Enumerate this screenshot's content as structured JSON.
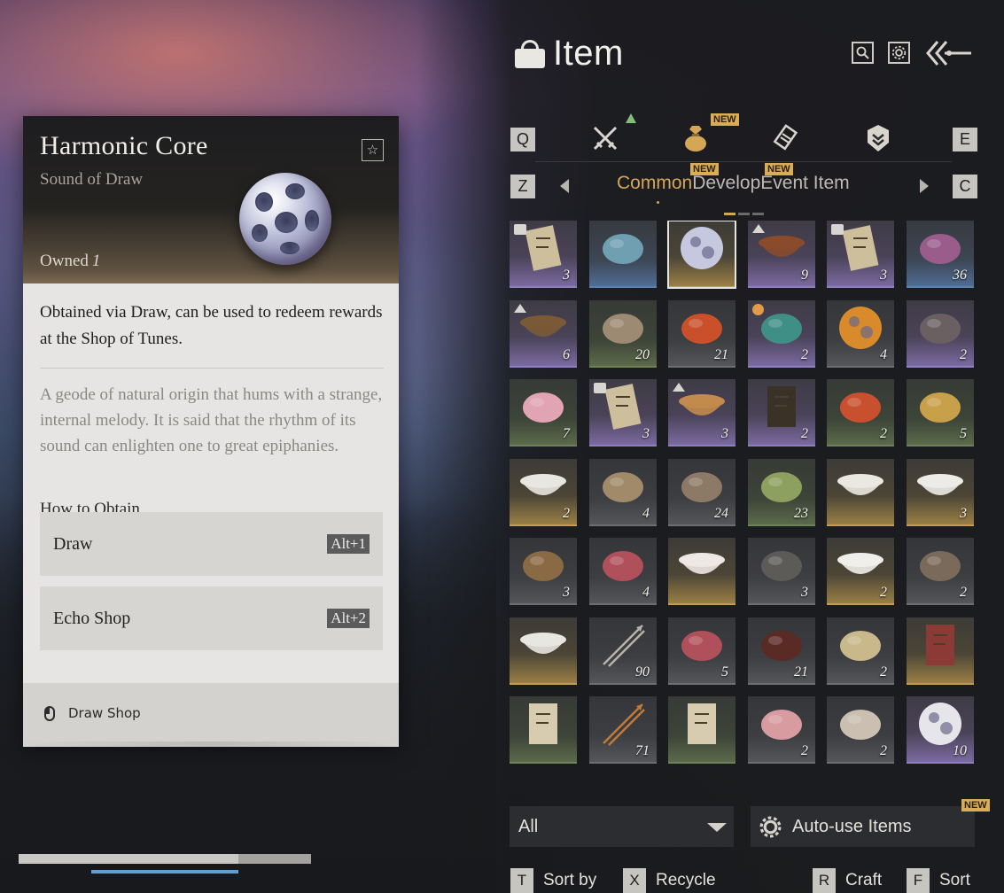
{
  "detail": {
    "title": "Harmonic Core",
    "subtitle": "Sound of Draw",
    "owned_label": "Owned",
    "owned_count": "1",
    "description": "Obtained via Draw, can be used to redeem rewards at the Shop of Tunes.",
    "lore": "A geode of natural origin that hums with a strange, internal melody. It is said that the rhythm of its sound can enlighten one to great epiphanies.",
    "how_to_obtain_label": "How to Obtain",
    "sources": [
      {
        "label": "Draw",
        "hotkey": "Alt+1"
      },
      {
        "label": "Echo Shop",
        "hotkey": "Alt+2"
      }
    ],
    "footer_label": "Draw Shop",
    "favorite_icon": "star-icon"
  },
  "panel": {
    "title": "Item",
    "title_icon": "bundle-icon",
    "header_icons": [
      "search-icon",
      "settings-icon",
      "back-arrow-icon"
    ],
    "category_keys": {
      "left": "Q",
      "right": "E"
    },
    "categories": [
      {
        "icon": "crossed-swords-icon",
        "badge": ""
      },
      {
        "icon": "pouch-icon",
        "badge": "NEW",
        "active": true
      },
      {
        "icon": "scroll-icon",
        "badge": ""
      },
      {
        "icon": "emblem-icon",
        "badge": ""
      }
    ],
    "subtab_keys": {
      "left": "Z",
      "right": "C"
    },
    "subtabs": [
      {
        "label": "Common",
        "badge": "",
        "active": true
      },
      {
        "label": "Develop",
        "badge": "NEW"
      },
      {
        "label": "Event Item",
        "badge": "NEW"
      }
    ]
  },
  "items": [
    {
      "icon": "letter-icon",
      "count": "3",
      "rarity": "purple",
      "mark": "chat"
    },
    {
      "icon": "cloth-bag-icon",
      "count": "",
      "rarity": "blue",
      "mark": ""
    },
    {
      "icon": "harmonic-core-icon",
      "count": "",
      "rarity": "gold",
      "mark": "",
      "selected": true
    },
    {
      "icon": "stew-bowl-icon",
      "count": "9",
      "rarity": "purple",
      "mark": "arrow"
    },
    {
      "icon": "letter-icon",
      "count": "3",
      "rarity": "purple",
      "mark": "chat"
    },
    {
      "icon": "gift-box-icon",
      "count": "36",
      "rarity": "blue",
      "mark": ""
    },
    {
      "icon": "soup-pot-icon",
      "count": "6",
      "rarity": "purple",
      "mark": "arrow"
    },
    {
      "icon": "animal-hide-icon",
      "count": "20",
      "rarity": "green",
      "mark": ""
    },
    {
      "icon": "red-gem-icon",
      "count": "21",
      "rarity": "gray",
      "mark": ""
    },
    {
      "icon": "tea-box-icon",
      "count": "2",
      "rarity": "purple",
      "mark": "clock"
    },
    {
      "icon": "pearl-stand-icon",
      "count": "4",
      "rarity": "gray",
      "mark": ""
    },
    {
      "icon": "horn-icon",
      "count": "2",
      "rarity": "purple",
      "mark": ""
    },
    {
      "icon": "plum-blossom-icon",
      "count": "7",
      "rarity": "green",
      "mark": ""
    },
    {
      "icon": "letter-icon",
      "count": "3",
      "rarity": "purple",
      "mark": "chat"
    },
    {
      "icon": "pastry-plate-icon",
      "count": "3",
      "rarity": "purple",
      "mark": "arrow"
    },
    {
      "icon": "talisman-icon",
      "count": "2",
      "rarity": "purple",
      "mark": ""
    },
    {
      "icon": "berries-icon",
      "count": "2",
      "rarity": "green",
      "mark": ""
    },
    {
      "icon": "carp-icon",
      "count": "5",
      "rarity": "green",
      "mark": ""
    },
    {
      "icon": "plate-icon",
      "count": "2",
      "rarity": "gold",
      "mark": ""
    },
    {
      "icon": "grain-sack-icon",
      "count": "4",
      "rarity": "gray",
      "mark": ""
    },
    {
      "icon": "wood-pieces-icon",
      "count": "24",
      "rarity": "gray",
      "mark": ""
    },
    {
      "icon": "bamboo-icon",
      "count": "23",
      "rarity": "green",
      "mark": ""
    },
    {
      "icon": "rooster-bowl-icon",
      "count": "",
      "rarity": "gold",
      "mark": ""
    },
    {
      "icon": "lidded-bowl-icon",
      "count": "3",
      "rarity": "gold",
      "mark": ""
    },
    {
      "icon": "straw-icon",
      "count": "3",
      "rarity": "gray",
      "mark": ""
    },
    {
      "icon": "raw-meat-icon",
      "count": "4",
      "rarity": "gray",
      "mark": ""
    },
    {
      "icon": "flower-bowl-icon",
      "count": "",
      "rarity": "gold",
      "mark": ""
    },
    {
      "icon": "rock-icon",
      "count": "3",
      "rarity": "gray",
      "mark": ""
    },
    {
      "icon": "white-bowl-icon",
      "count": "2",
      "rarity": "gold",
      "mark": ""
    },
    {
      "icon": "logs-icon",
      "count": "2",
      "rarity": "gray",
      "mark": ""
    },
    {
      "icon": "porcelain-bowl-icon",
      "count": "",
      "rarity": "gold",
      "mark": ""
    },
    {
      "icon": "arrows-icon",
      "count": "90",
      "rarity": "gray",
      "mark": ""
    },
    {
      "icon": "raw-meat-icon",
      "count": "5",
      "rarity": "gray",
      "mark": ""
    },
    {
      "icon": "wine-jar-icon",
      "count": "21",
      "rarity": "gray",
      "mark": ""
    },
    {
      "icon": "eggs-icon",
      "count": "2",
      "rarity": "gray",
      "mark": ""
    },
    {
      "icon": "red-book-icon",
      "count": "",
      "rarity": "gold",
      "mark": ""
    },
    {
      "icon": "scroll-paper-icon",
      "count": "",
      "rarity": "green",
      "mark": ""
    },
    {
      "icon": "fire-arrows-icon",
      "count": "71",
      "rarity": "gray",
      "mark": ""
    },
    {
      "icon": "scroll-paper-icon",
      "count": "",
      "rarity": "green",
      "mark": ""
    },
    {
      "icon": "meat-chunks-icon",
      "count": "2",
      "rarity": "gray",
      "mark": ""
    },
    {
      "icon": "oysters-icon",
      "count": "2",
      "rarity": "gray",
      "mark": ""
    },
    {
      "icon": "mountain-token-icon",
      "count": "10",
      "rarity": "purple",
      "mark": ""
    }
  ],
  "controls": {
    "filter_value": "All",
    "autouse_label": "Auto-use Items",
    "autouse_badge": "NEW",
    "actions": [
      {
        "key": "T",
        "label": "Sort by"
      },
      {
        "key": "X",
        "label": "Recycle"
      },
      {
        "key": "R",
        "label": "Craft"
      },
      {
        "key": "F",
        "label": "Sort"
      }
    ]
  },
  "colors": {
    "accent_gold": "#d4a758",
    "rarity_purple": "#8f7fc0",
    "rarity_gold": "#c59b4e",
    "rarity_green": "#6f8158",
    "rarity_blue": "#5b82b1"
  }
}
